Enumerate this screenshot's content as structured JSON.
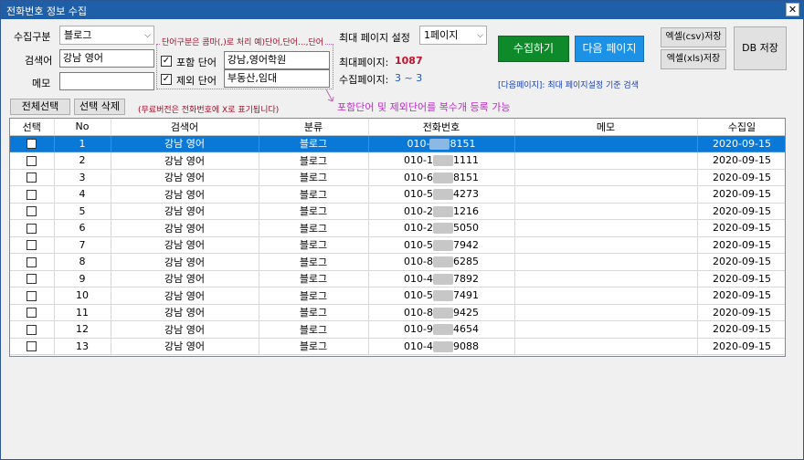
{
  "window": {
    "title": "전화번호 정보 수집",
    "close_glyph": "✕"
  },
  "form": {
    "collect_type_label": "수집구분",
    "collect_type_value": "블로그",
    "keyword_label": "검색어",
    "keyword_value": "강남 영어",
    "memo_label": "메모",
    "memo_value": ""
  },
  "filters": {
    "hint": "단어구분은 콤마(,)로 처리 예)단어,단어...,단어",
    "include_label": "포함 단어",
    "include_value": "강남,영어학원",
    "exclude_label": "제외 단어",
    "exclude_value": "부동산,임대",
    "check_glyph": "✓"
  },
  "pages": {
    "max_setting_label": "최대 페이지 설정",
    "max_setting_value": "1페이지",
    "max_pages_label": "최대페이지:",
    "max_pages_value": "1087",
    "collected_pages_label": "수집페이지:",
    "collected_pages_value": "3 ~ 3"
  },
  "actions": {
    "collect": "수집하기",
    "next_page": "다음 페이지",
    "next_note": "[다음페이지]:  최대 페이지설정 기준 검색",
    "csv_save": "엑셀(csv)저장",
    "xls_save": "엑셀(xls)저장",
    "db_save": "DB 저장",
    "select_all": "전체선택",
    "delete_selected": "선택 삭제",
    "free_note": "(무료버전은 전화번호에 X로 표기됩니다)",
    "multi_note": "포함단어 및 제외단어를 복수개 등록 가능"
  },
  "table": {
    "headers": [
      "선택",
      "No",
      "검색어",
      "분류",
      "전화번호",
      "메모",
      "수집일"
    ],
    "rows": [
      {
        "no": "1",
        "keyword": "강남 영어",
        "category": "블로그",
        "phone_prefix": "010-",
        "phone_suffix": "8151",
        "memo": "",
        "date": "2020-09-15"
      },
      {
        "no": "2",
        "keyword": "강남 영어",
        "category": "블로그",
        "phone_prefix": "010-1",
        "phone_suffix": "1111",
        "memo": "",
        "date": "2020-09-15"
      },
      {
        "no": "3",
        "keyword": "강남 영어",
        "category": "블로그",
        "phone_prefix": "010-6",
        "phone_suffix": "8151",
        "memo": "",
        "date": "2020-09-15"
      },
      {
        "no": "4",
        "keyword": "강남 영어",
        "category": "블로그",
        "phone_prefix": "010-5",
        "phone_suffix": "4273",
        "memo": "",
        "date": "2020-09-15"
      },
      {
        "no": "5",
        "keyword": "강남 영어",
        "category": "블로그",
        "phone_prefix": "010-2",
        "phone_suffix": "1216",
        "memo": "",
        "date": "2020-09-15"
      },
      {
        "no": "6",
        "keyword": "강남 영어",
        "category": "블로그",
        "phone_prefix": "010-2",
        "phone_suffix": "5050",
        "memo": "",
        "date": "2020-09-15"
      },
      {
        "no": "7",
        "keyword": "강남 영어",
        "category": "블로그",
        "phone_prefix": "010-5",
        "phone_suffix": "7942",
        "memo": "",
        "date": "2020-09-15"
      },
      {
        "no": "8",
        "keyword": "강남 영어",
        "category": "블로그",
        "phone_prefix": "010-8",
        "phone_suffix": "6285",
        "memo": "",
        "date": "2020-09-15"
      },
      {
        "no": "9",
        "keyword": "강남 영어",
        "category": "블로그",
        "phone_prefix": "010-4",
        "phone_suffix": "7892",
        "memo": "",
        "date": "2020-09-15"
      },
      {
        "no": "10",
        "keyword": "강남 영어",
        "category": "블로그",
        "phone_prefix": "010-5",
        "phone_suffix": "7491",
        "memo": "",
        "date": "2020-09-15"
      },
      {
        "no": "11",
        "keyword": "강남 영어",
        "category": "블로그",
        "phone_prefix": "010-8",
        "phone_suffix": "9425",
        "memo": "",
        "date": "2020-09-15"
      },
      {
        "no": "12",
        "keyword": "강남 영어",
        "category": "블로그",
        "phone_prefix": "010-9",
        "phone_suffix": "4654",
        "memo": "",
        "date": "2020-09-15"
      },
      {
        "no": "13",
        "keyword": "강남 영어",
        "category": "블로그",
        "phone_prefix": "010-4",
        "phone_suffix": "9088",
        "memo": "",
        "date": "2020-09-15"
      }
    ]
  }
}
